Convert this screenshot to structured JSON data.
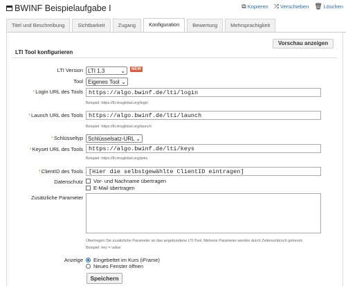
{
  "header": {
    "title": "BWINF Beispielaufgabe I",
    "actions": [
      {
        "label": "Kopieren",
        "icon": "copy-icon"
      },
      {
        "label": "Verschieben",
        "icon": "move-icon"
      },
      {
        "label": "Löschen",
        "icon": "trash-icon"
      }
    ]
  },
  "tabs": [
    "Titel und Beschreibung",
    "Sichtbarkeit",
    "Zugang",
    "Konfiguration",
    "Bewertung",
    "Mehrsprachigkeit"
  ],
  "active_tab": "Konfiguration",
  "preview_button": "Vorschau anzeigen",
  "section_title": "LTI Tool konfigurieren",
  "form": {
    "lti_version": {
      "label": "LTI Version",
      "value": "LTI 1.3",
      "badge": "NEW"
    },
    "tool": {
      "label": "Tool",
      "value": "Eigenes Tool"
    },
    "login_url": {
      "label": "Login URL des Tools",
      "value": "https://algo.bwinf.de/lti/login",
      "hint": "Beispiel: https://lti.imsglobal.org/login"
    },
    "launch_url": {
      "label": "Launch URL des Tools",
      "value": "https://algo.bwinf.de/lti/launch",
      "hint": "Beispiel: https://lti.imsglobal.org/launch"
    },
    "key_type": {
      "label": "Schlüsseltyp",
      "value": "Schlüsselsatz-URL"
    },
    "keyset_url": {
      "label": "Keyset URL des Tools",
      "value": "https://algo.bwinf.de/lti/keys",
      "hint": "Beispiel: https://lti.imsglobal.org/jwks"
    },
    "client_id": {
      "label": "ClientID des Tools",
      "value": "[Hier die selbstgewählte ClientID eintragen]"
    },
    "privacy": {
      "label": "Datenschutz",
      "options": [
        "Vor- und Nachname übertragen",
        "E-Mail übertragen"
      ]
    },
    "params": {
      "label": "Zusätzliche Parameter",
      "hint1": "Übertragen Sie zusätzliche Parameter an das angebundene LTI-Tool. Mehrere Parameter werden durch Zeilenumbruch getrennt.",
      "hint2": "Beispiel: key = value"
    },
    "display": {
      "label": "Anzeige",
      "options": [
        "Eingebettet im Kurs (iFrame)",
        "Neues Fenster öffnen"
      ]
    }
  },
  "save_button": "Speichern"
}
